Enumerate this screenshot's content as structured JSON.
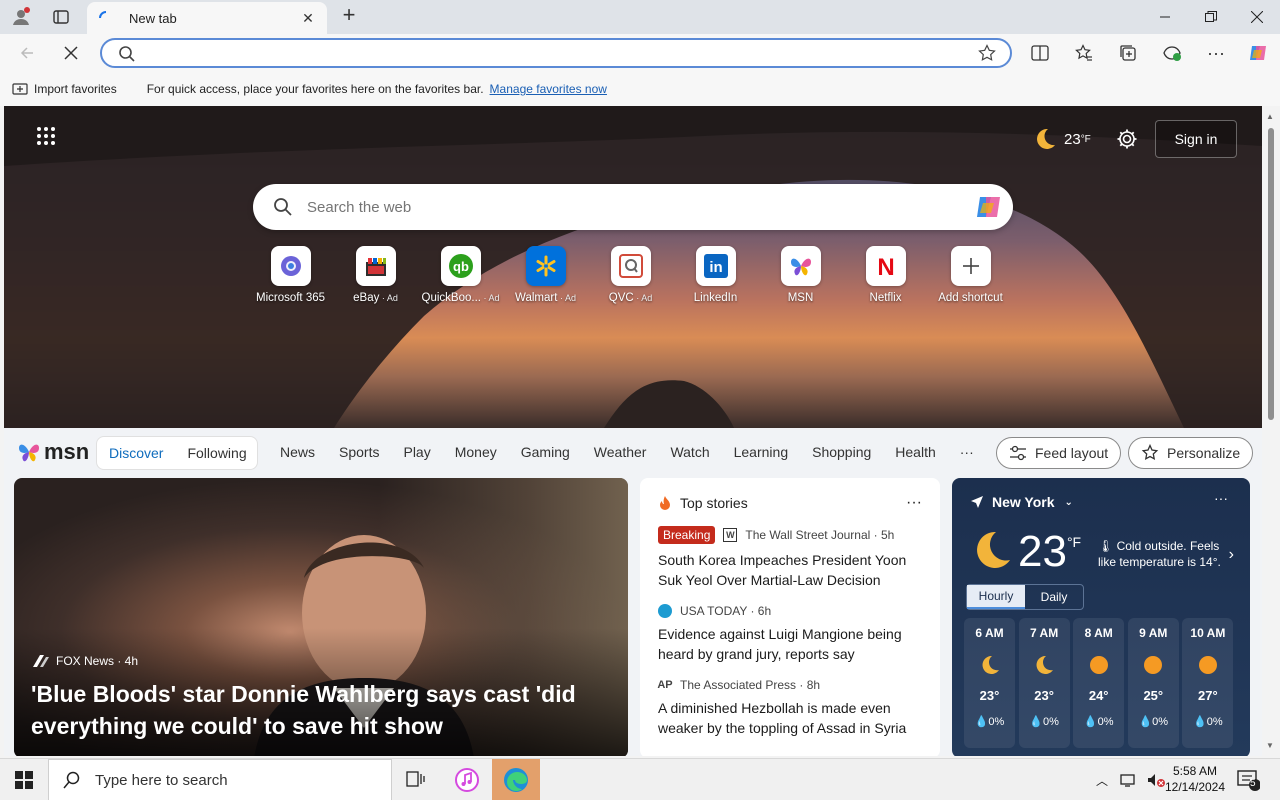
{
  "browser": {
    "tab_title": "New tab",
    "address_value": "",
    "favorites_bar": {
      "import_label": "Import favorites",
      "message": "For quick access, place your favorites here on the favorites bar.",
      "manage_link": "Manage favorites now"
    }
  },
  "newtab": {
    "weather_top": {
      "temp": "23",
      "unit": "°F"
    },
    "sign_in_label": "Sign in",
    "search_placeholder": "Search the web",
    "shortcuts": [
      {
        "label": "Microsoft 365",
        "ad": ""
      },
      {
        "label": "eBay",
        "ad": " · Ad"
      },
      {
        "label": "QuickBoo...",
        "ad": " · Ad"
      },
      {
        "label": "Walmart",
        "ad": " · Ad"
      },
      {
        "label": "QVC",
        "ad": " · Ad"
      },
      {
        "label": "LinkedIn",
        "ad": ""
      },
      {
        "label": "MSN",
        "ad": ""
      },
      {
        "label": "Netflix",
        "ad": ""
      },
      {
        "label": "Add shortcut",
        "ad": ""
      }
    ]
  },
  "feed": {
    "logo_text": "msn",
    "discover_label": "Discover",
    "following_label": "Following",
    "categories": [
      "News",
      "Sports",
      "Play",
      "Money",
      "Gaming",
      "Weather",
      "Watch",
      "Learning",
      "Shopping",
      "Health"
    ],
    "more_label": "···",
    "feed_layout_label": "Feed layout",
    "personalize_label": "Personalize",
    "main_story": {
      "source": "FOX News · 4h",
      "headline": "'Blue Bloods' star Donnie Wahlberg says cast 'did everything we could' to save hit show"
    },
    "top_stories": {
      "title": "Top stories",
      "items": [
        {
          "badge": "Breaking",
          "source": "The Wall Street Journal · 5h",
          "title": "South Korea Impeaches President Yoon Suk Yeol Over Martial-Law Decision"
        },
        {
          "badge": "",
          "source": "USA TODAY · 6h",
          "title": "Evidence against Luigi Mangione being heard by grand jury, reports say"
        },
        {
          "badge": "",
          "source": "The Associated Press · 8h",
          "title": "A diminished Hezbollah is made even weaker by the toppling of Assad in Syria"
        }
      ]
    },
    "weather": {
      "location": "New York",
      "temp": "23",
      "unit": "°F",
      "note": "Cold outside. Feels like temperature is 14°.",
      "tab_hourly": "Hourly",
      "tab_daily": "Daily",
      "hours": [
        {
          "time": "6 AM",
          "temp": "23°",
          "precip": "0%",
          "icon": "moon"
        },
        {
          "time": "7 AM",
          "temp": "23°",
          "precip": "0%",
          "icon": "moon"
        },
        {
          "time": "8 AM",
          "temp": "24°",
          "precip": "0%",
          "icon": "sun"
        },
        {
          "time": "9 AM",
          "temp": "25°",
          "precip": "0%",
          "icon": "sun"
        },
        {
          "time": "10 AM",
          "temp": "27°",
          "precip": "0%",
          "icon": "sun"
        }
      ]
    }
  },
  "taskbar": {
    "search_placeholder": "Type here to search",
    "time": "5:58 AM",
    "date": "12/14/2024",
    "notification_count": "5"
  },
  "colors": {
    "accent": "#0f6cbd",
    "breaking": "#c42b1c",
    "edge_active": "#e3a06b"
  }
}
